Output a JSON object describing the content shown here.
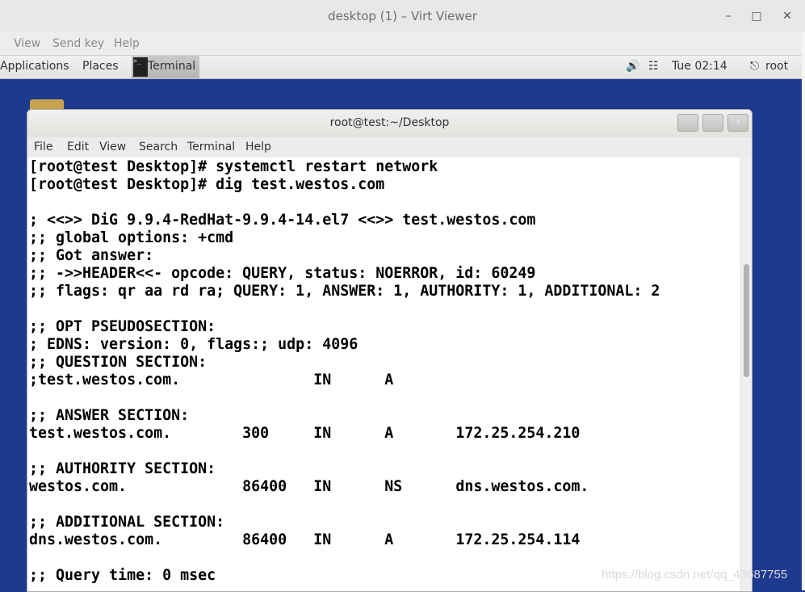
{
  "viewer": {
    "title": "desktop (1) – Virt Viewer",
    "menu": [
      "View",
      "Send key",
      "Help"
    ],
    "controls": {
      "minimize": "–",
      "maximize": "□",
      "close": "✕"
    }
  },
  "panel": {
    "applications": "Applications",
    "places": "Places",
    "taskbar_terminal": "Terminal",
    "clock": "Tue 02:14",
    "user": "root",
    "icons": [
      "volume-icon",
      "network-icon",
      "user-icon"
    ]
  },
  "terminal": {
    "title": "root@test:~/Desktop",
    "menu": [
      "File",
      "Edit",
      "View",
      "Search",
      "Terminal",
      "Help"
    ],
    "lines": [
      "[root@test Desktop]# systemctl restart network",
      "[root@test Desktop]# dig test.westos.com",
      "",
      "; <<>> DiG 9.9.4-RedHat-9.9.4-14.el7 <<>> test.westos.com",
      ";; global options: +cmd",
      ";; Got answer:",
      ";; ->>HEADER<<- opcode: QUERY, status: NOERROR, id: 60249",
      ";; flags: qr aa rd ra; QUERY: 1, ANSWER: 1, AUTHORITY: 1, ADDITIONAL: 2",
      "",
      ";; OPT PSEUDOSECTION:",
      "; EDNS: version: 0, flags:; udp: 4096",
      ";; QUESTION SECTION:",
      ";test.westos.com.\t\tIN\tA",
      "",
      ";; ANSWER SECTION:",
      "test.westos.com.\t300\tIN\tA\t172.25.254.210",
      "",
      ";; AUTHORITY SECTION:",
      "westos.com.\t\t86400\tIN\tNS\tdns.westos.com.",
      "",
      ";; ADDITIONAL SECTION:",
      "dns.westos.com.\t\t86400\tIN\tA\t172.25.254.114",
      "",
      ";; Query time: 0 msec"
    ]
  },
  "watermark": "https://blog.csdn.net/qq_43687755"
}
